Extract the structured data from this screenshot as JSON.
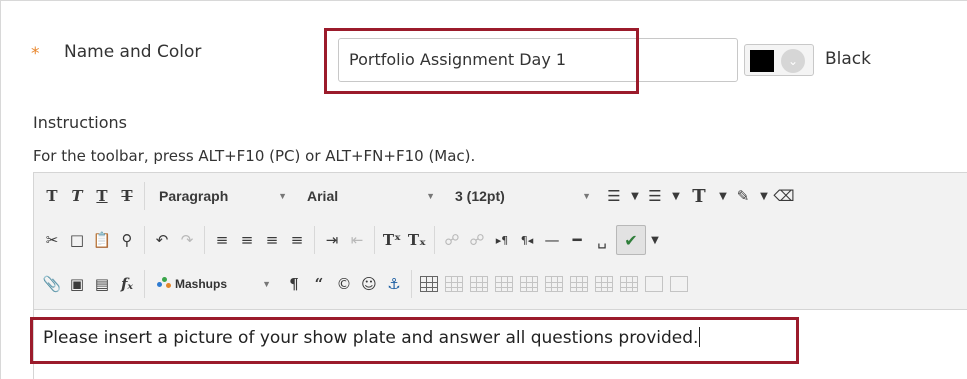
{
  "form": {
    "required_marker": "*",
    "name_label": "Name and Color",
    "name_value": "Portfolio Assignment Day 1",
    "color": {
      "swatch_hex": "#000000",
      "name": "Black"
    },
    "instructions_label": "Instructions",
    "toolbar_help": "For the toolbar, press ALT+F10 (PC) or ALT+FN+F10 (Mac)."
  },
  "toolbar": {
    "row1": {
      "format_buttons": [
        {
          "name": "bold-button",
          "glyph": "T"
        },
        {
          "name": "italic-button",
          "glyph": "T"
        },
        {
          "name": "underline-button",
          "glyph": "T"
        },
        {
          "name": "strikethrough-button",
          "glyph": "T"
        }
      ],
      "paragraph_select": "Paragraph",
      "font_select": "Arial",
      "size_select": "3 (12pt)"
    },
    "row3": {
      "mashups_label": "Mashups"
    }
  },
  "editor": {
    "content": "Please insert a picture of your show plate and answer all questions provided."
  },
  "colors": {
    "highlight": "#9b1b2b",
    "required": "#e8862c",
    "spellcheck": "#2f7e3a"
  }
}
